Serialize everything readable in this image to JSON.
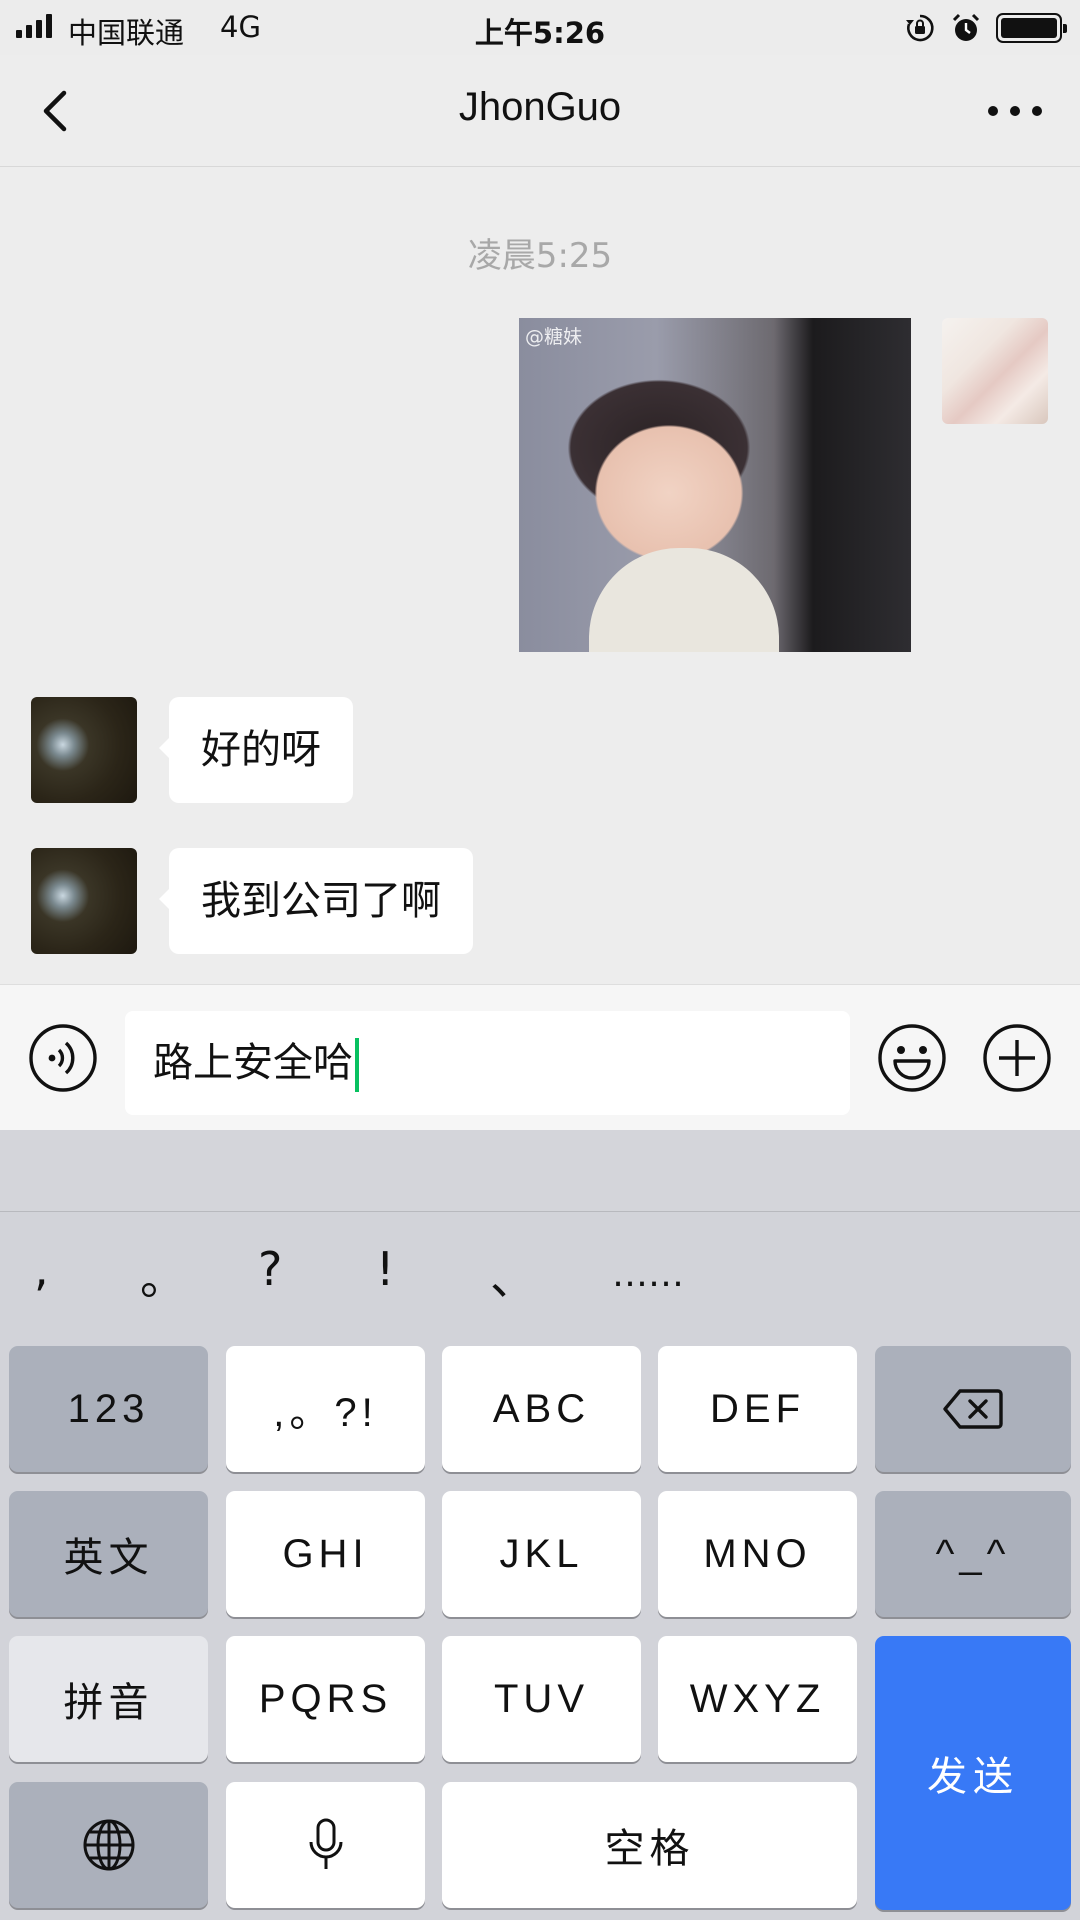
{
  "status_bar": {
    "carrier": "中国联通",
    "network": "4G",
    "time": "上午5:26"
  },
  "header": {
    "title": "JhonGuo"
  },
  "chat": {
    "timestamp": "凌晨5:25",
    "image_watermark": "@糖妹",
    "messages": [
      {
        "sender": "other",
        "text": "好的呀"
      },
      {
        "sender": "other",
        "text": "我到公司了啊"
      }
    ]
  },
  "input": {
    "value": "路上安全哈"
  },
  "keyboard": {
    "punctuation": [
      ",",
      "。",
      "?",
      "!",
      "、",
      "……"
    ],
    "rows": [
      [
        "123",
        ",。?!",
        "ABC",
        "DEF",
        "backspace"
      ],
      [
        "英文",
        "GHI",
        "JKL",
        "MNO",
        "^_^"
      ],
      [
        "拼音",
        "PQRS",
        "TUV",
        "WXYZ"
      ],
      [
        "globe",
        "microphone",
        "空格"
      ]
    ],
    "send_label": "发送",
    "send_color": "#3879f6"
  }
}
